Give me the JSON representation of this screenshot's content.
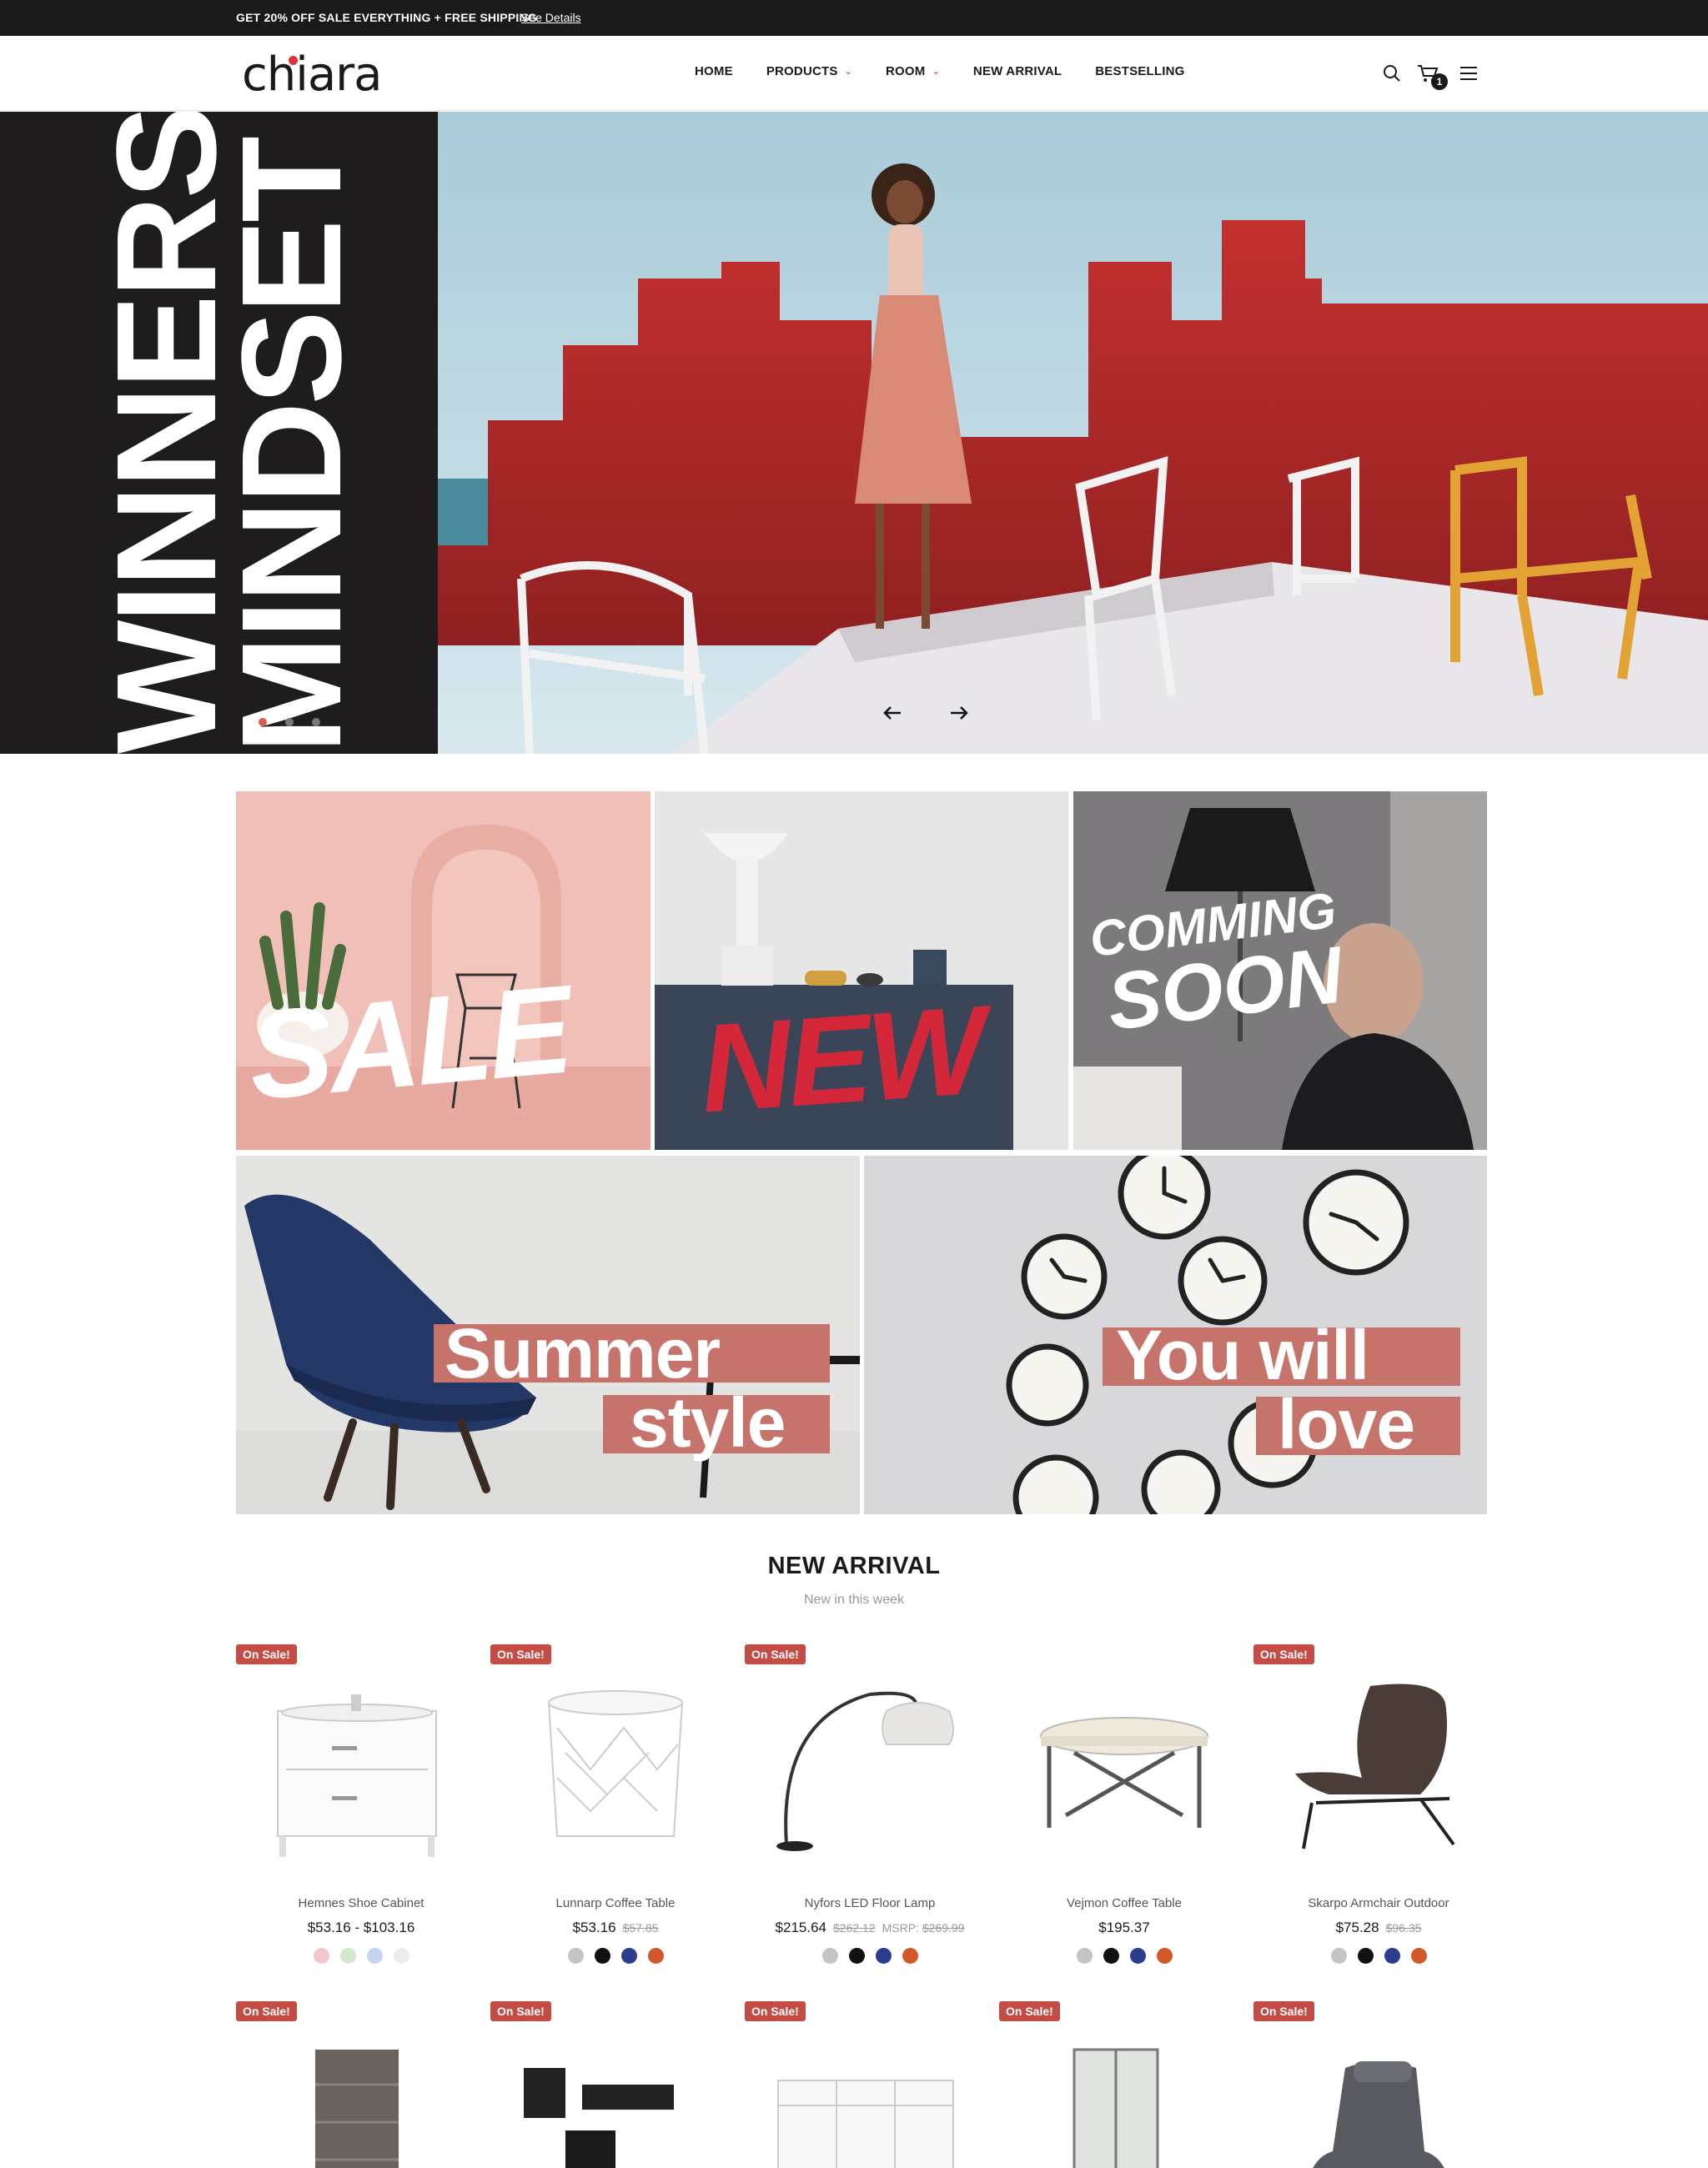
{
  "promo": {
    "text": "GET 20% OFF SALE EVERYTHING + FREE SHIPPING",
    "link": "See Details"
  },
  "header": {
    "logo": "chiara",
    "nav": [
      {
        "label": "HOME",
        "has_dropdown": false
      },
      {
        "label": "PRODUCTS",
        "has_dropdown": true
      },
      {
        "label": "ROOM",
        "has_dropdown": true
      },
      {
        "label": "NEW ARRIVAL",
        "has_dropdown": false
      },
      {
        "label": "BESTSELLING",
        "has_dropdown": false
      }
    ],
    "icons": [
      "search-icon",
      "cart-icon",
      "menu-icon"
    ],
    "cart_count": "1"
  },
  "hero": {
    "title_line1": "WINNERS",
    "title_line2": "MINDSET",
    "slides": 3,
    "active_slide": 1
  },
  "banners": {
    "sale": "SALE",
    "new": "NEW",
    "coming_line1": "COMMING",
    "coming_line2": "SOON",
    "summer_line1": "Summer",
    "summer_line2": "style",
    "love_line1": "You will",
    "love_line2": "love"
  },
  "new_arrival": {
    "title": "NEW ARRIVAL",
    "subtitle": "New in this week",
    "badge": "On Sale!",
    "products": [
      {
        "name": "Hemnes Shoe Cabinet",
        "price": "$53.16 - $103.16",
        "old_price": "",
        "msrp": "",
        "swatches": [
          "#f3c8cc",
          "#cfe9cf",
          "#c6d4ef",
          "#ececec"
        ]
      },
      {
        "name": "Lunnarp Coffee Table",
        "price": "$53.16",
        "old_price": "$57.85",
        "msrp": "",
        "swatches": [
          "#c4c4c4",
          "#111111",
          "#2d3d8e",
          "#d2572a"
        ]
      },
      {
        "name": "Nyfors LED Floor Lamp",
        "price": "$215.64",
        "old_price": "$262.12",
        "msrp_label": "MSRP:",
        "msrp": "$269.99",
        "swatches": [
          "#c4c4c4",
          "#111111",
          "#2d3d8e",
          "#d2572a"
        ]
      },
      {
        "name": "Vejmon Coffee Table",
        "price": "$195.37",
        "old_price": "",
        "msrp": "",
        "swatches": [
          "#c4c4c4",
          "#111111",
          "#2d3d8e",
          "#d2572a"
        ]
      },
      {
        "name": "Skarpo Armchair Outdoor",
        "price": "$75.28",
        "old_price": "$96.35",
        "msrp": "",
        "swatches": [
          "#c4c4c4",
          "#111111",
          "#2d3d8e",
          "#d2572a"
        ]
      }
    ]
  },
  "colors": {
    "accent": "#c54c44",
    "dark": "#1a1a1a",
    "stripe": "#c5736b"
  }
}
